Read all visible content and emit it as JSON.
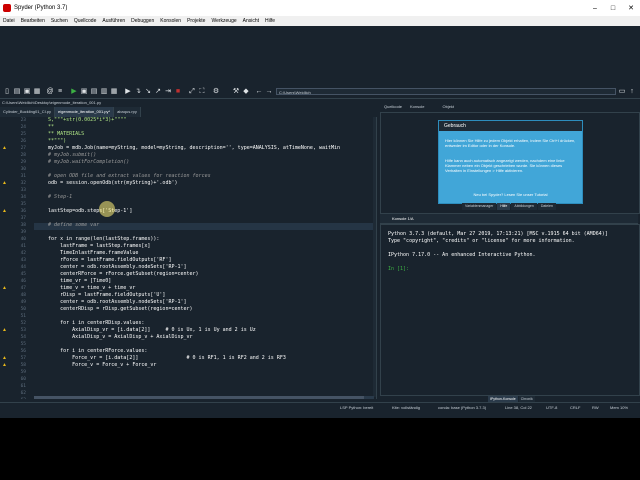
{
  "window": {
    "title": "Spyder (Python 3.7)"
  },
  "menu": [
    "Datei",
    "Bearbeiten",
    "Suchen",
    "Quellcode",
    "Ausführen",
    "Debuggen",
    "Konsolen",
    "Projekte",
    "Werkzeuge",
    "Ansicht",
    "Hilfe"
  ],
  "toolbar": {
    "path": "C:\\Users\\Weidlich"
  },
  "editor": {
    "filepath": "C:\\Users\\Weidlich\\Desktop\\eigenmode_iteration_001.py",
    "tabs": [
      "Cylinder_Buckling01_CI.py",
      "eigenmode_iteration_001.py*",
      "abaqus.rpy"
    ]
  },
  "code_lines": [
    {
      "n": "23",
      "t": "    S,\"\"\"+str(0.0025*i*3)+\"\"\"\"",
      "c": "c-str",
      "w": false
    },
    {
      "n": "24",
      "t": "    **",
      "c": "c-str",
      "w": false
    },
    {
      "n": "25",
      "t": "    ** MATERIALS",
      "c": "c-str",
      "w": false
    },
    {
      "n": "26",
      "t": "    **\"\"\")",
      "c": "c-str",
      "w": false
    },
    {
      "n": "27",
      "t": "    myJob = mdb.Job(name=myString, model=myString, description='', type=ANALYSIS, atTimeNone, waitMin",
      "c": "c-txt",
      "w": true
    },
    {
      "n": "28",
      "t": "    # myJob.submit()",
      "c": "c-com",
      "w": false
    },
    {
      "n": "29",
      "t": "    # myJob.waitForCompletion()",
      "c": "c-com",
      "w": false
    },
    {
      "n": "30",
      "t": "",
      "c": "c-txt",
      "w": false
    },
    {
      "n": "31",
      "t": "    # open ODB file and extract values for reaction forces",
      "c": "c-com",
      "w": false
    },
    {
      "n": "32",
      "t": "    odb = session.openOdb(str(myString)+'.odb')",
      "c": "c-txt",
      "w": true
    },
    {
      "n": "33",
      "t": "",
      "c": "c-txt",
      "w": false
    },
    {
      "n": "34",
      "t": "    # Step-1",
      "c": "c-com",
      "w": false
    },
    {
      "n": "35",
      "t": "",
      "c": "c-txt",
      "w": false
    },
    {
      "n": "36",
      "t": "    lastStep=odb.steps['Step-1']",
      "c": "c-txt",
      "w": true
    },
    {
      "n": "37",
      "t": "",
      "c": "c-txt",
      "w": false
    },
    {
      "n": "38",
      "t": "    # define some var",
      "c": "c-com",
      "w": false
    },
    {
      "n": "39",
      "t": "",
      "c": "c-txt",
      "w": false
    },
    {
      "n": "40",
      "t": "    for x in range(len(lastStep.frames)):",
      "c": "c-txt",
      "w": false
    },
    {
      "n": "41",
      "t": "        lastFrame = lastStep.frames[x]",
      "c": "c-txt",
      "w": false
    },
    {
      "n": "42",
      "t": "        TimeInlastFrame.frameValue",
      "c": "c-txt",
      "w": false
    },
    {
      "n": "43",
      "t": "        rForce = lastFrame.fieldOutputs['RF']",
      "c": "c-txt",
      "w": false
    },
    {
      "n": "44",
      "t": "        center = odb.rootAssembly.nodeSets['RP-1']",
      "c": "c-txt",
      "w": false
    },
    {
      "n": "45",
      "t": "        centerRForce = rForce.getSubset(region=center)",
      "c": "c-txt",
      "w": false
    },
    {
      "n": "46",
      "t": "        time_vr = [Time0]",
      "c": "c-txt",
      "w": false
    },
    {
      "n": "47",
      "t": "        time_v = time_v + time_vr",
      "c": "c-txt",
      "w": true
    },
    {
      "n": "48",
      "t": "        rDisp = lastFrame.fieldOutputs['U']",
      "c": "c-txt",
      "w": false
    },
    {
      "n": "49",
      "t": "        center = odb.rootAssembly.nodeSets['RP-1']",
      "c": "c-txt",
      "w": false
    },
    {
      "n": "50",
      "t": "        centerRDisp = rDisp.getSubset(region=center)",
      "c": "c-txt",
      "w": false
    },
    {
      "n": "51",
      "t": "",
      "c": "c-txt",
      "w": false
    },
    {
      "n": "52",
      "t": "        for i in centerRDisp.values:",
      "c": "c-txt",
      "w": false
    },
    {
      "n": "53",
      "t": "            AxialDisp_vr = [i.data[2]]     # 0 is Ux, 1 is Uy and 2 is Uz",
      "c": "c-txt",
      "w": true
    },
    {
      "n": "54",
      "t": "            AxialDisp_v = AxialDisp_v + AxialDisp_vr",
      "c": "c-txt",
      "w": false
    },
    {
      "n": "55",
      "t": "",
      "c": "c-txt",
      "w": false
    },
    {
      "n": "56",
      "t": "        for i in centerRForce.values:",
      "c": "c-txt",
      "w": false
    },
    {
      "n": "57",
      "t": "            Force_vr = [i.data[2]]                # 0 is RF1, 1 is RF2 and 2 is RF3",
      "c": "c-txt",
      "w": true
    },
    {
      "n": "58",
      "t": "            Force_v = Force_v + Force_vr",
      "c": "c-txt",
      "w": true
    },
    {
      "n": "59",
      "t": "",
      "c": "c-txt",
      "w": false
    },
    {
      "n": "60",
      "t": "",
      "c": "c-txt",
      "w": false
    },
    {
      "n": "61",
      "t": "",
      "c": "c-txt",
      "w": false
    },
    {
      "n": "62",
      "t": "",
      "c": "c-txt",
      "w": false
    },
    {
      "n": "63",
      "t": "",
      "c": "c-txt",
      "w": false
    }
  ],
  "help": {
    "tabs": [
      "Quellcode",
      "Konsole",
      "Objekt"
    ],
    "box_title": "Gebrauch",
    "p1": "Hier können Sie Hilfe zu jedem Objekt erhalten, indem Sie Ctrl+I drücken, entweder im Editor oder in der Konsole.",
    "p2": "Hilfe kann auch automatisch angezeigt werden, nachdem eine linke Klammer neben ein Objekt geschrieben wurde. Sie können dieses Verhalten in Einstellungen > Hilfe aktivieren.",
    "link": "Neu bei Spyder? Lesen Sie unser Tutorial",
    "bottom_tabs": [
      "Variablenmanager",
      "Hilfe",
      "Abbildungen",
      "Dateien"
    ]
  },
  "console": {
    "tab": "Konsole 1/A",
    "lines": [
      "Python 3.7.3 (default, Mar 27 2019, 17:13:21) [MSC v.1915 64 bit (AMD64)]",
      "Type \"copyright\", \"credits\" or \"license\" for more information.",
      "",
      "IPython 7.17.0 -- An enhanced Interactive Python.",
      ""
    ],
    "prompt": "In [1]:",
    "bottom_tabs": [
      "IPython-Konsole",
      "Chronik"
    ]
  },
  "status": {
    "lsp": "LSP Python: bereit",
    "kite": "Kite: vollständig",
    "conda": "conda: base (Python 3.7.3)",
    "pos": "Line 38, Col 22",
    "enc": "UTF-8",
    "eol": "CRLF",
    "rw": "RW",
    "mem": "Mem 10%"
  }
}
